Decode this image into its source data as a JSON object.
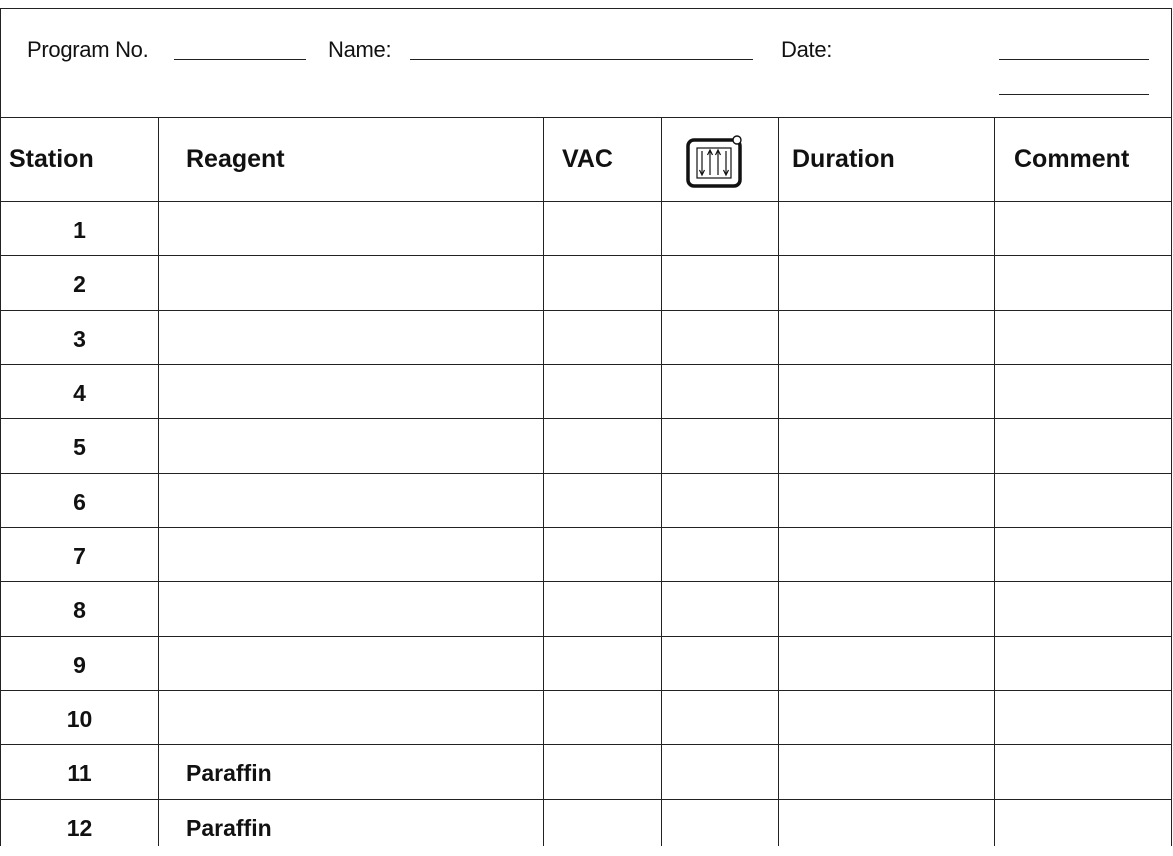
{
  "header": {
    "program_label": "Program No.",
    "name_label": "Name:",
    "date_label": "Date:"
  },
  "columns": {
    "station": "Station",
    "reagent": "Reagent",
    "vac": "VAC",
    "agitation_icon": "agitation-icon",
    "duration": "Duration",
    "comment": "Comment"
  },
  "rows": [
    {
      "station": "1",
      "reagent": ""
    },
    {
      "station": "2",
      "reagent": ""
    },
    {
      "station": "3",
      "reagent": ""
    },
    {
      "station": "4",
      "reagent": ""
    },
    {
      "station": "5",
      "reagent": ""
    },
    {
      "station": "6",
      "reagent": ""
    },
    {
      "station": "7",
      "reagent": ""
    },
    {
      "station": "8",
      "reagent": ""
    },
    {
      "station": "9",
      "reagent": ""
    },
    {
      "station": "10",
      "reagent": ""
    },
    {
      "station": "11",
      "reagent": "Paraffin"
    },
    {
      "station": "12",
      "reagent": "Paraffin"
    }
  ]
}
